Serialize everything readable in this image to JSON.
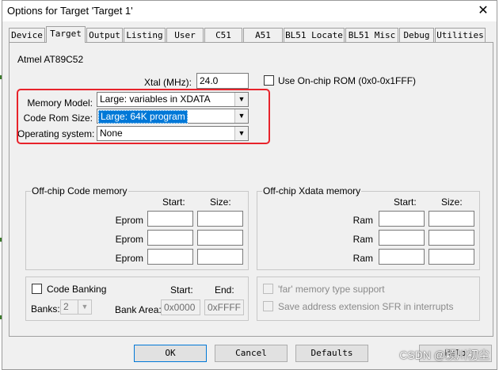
{
  "window": {
    "title": "Options for Target 'Target 1'",
    "close_symbol": "✕"
  },
  "tabs": [
    {
      "label": "Device"
    },
    {
      "label": "Target",
      "active": true
    },
    {
      "label": "Output"
    },
    {
      "label": "Listing"
    },
    {
      "label": "User"
    },
    {
      "label": "C51"
    },
    {
      "label": "A51"
    },
    {
      "label": "BL51 Locate"
    },
    {
      "label": "BL51 Misc"
    },
    {
      "label": "Debug"
    },
    {
      "label": "Utilities"
    }
  ],
  "target": {
    "device_name": "Atmel AT89C52",
    "xtal_label": "Xtal (MHz):",
    "xtal_value": "24.0",
    "onchip_rom_label": "Use On-chip ROM (0x0-0x1FFF)",
    "onchip_rom_checked": false,
    "memory_model_label": "Memory Model:",
    "memory_model_value": "Large: variables in XDATA",
    "code_rom_label": "Code Rom Size:",
    "code_rom_value": "Large: 64K program",
    "os_label": "Operating system:",
    "os_value": "None"
  },
  "offchip_code": {
    "title": "Off-chip Code memory",
    "start_header": "Start:",
    "size_header": "Size:",
    "rows": [
      {
        "label": "Eprom",
        "start": "",
        "size": ""
      },
      {
        "label": "Eprom",
        "start": "",
        "size": ""
      },
      {
        "label": "Eprom",
        "start": "",
        "size": ""
      }
    ]
  },
  "offchip_xdata": {
    "title": "Off-chip Xdata memory",
    "start_header": "Start:",
    "size_header": "Size:",
    "rows": [
      {
        "label": "Ram",
        "start": "",
        "size": ""
      },
      {
        "label": "Ram",
        "start": "",
        "size": ""
      },
      {
        "label": "Ram",
        "start": "",
        "size": ""
      }
    ]
  },
  "code_banking": {
    "label": "Code Banking",
    "checked": false,
    "banks_label": "Banks:",
    "banks_value": "2",
    "bank_area_label": "Bank Area:",
    "start_header": "Start:",
    "end_header": "End:",
    "start_value": "0x0000",
    "end_value": "0xFFFF"
  },
  "options": {
    "far_memory_label": "'far' memory type support",
    "save_sfr_label": "Save address extension SFR in interrupts"
  },
  "buttons": {
    "ok": "OK",
    "cancel": "Cancel",
    "defaults": "Defaults",
    "help": "Help"
  },
  "watermark": "CSDN @颖川初尘",
  "colors": {
    "highlight_box": "#e8232b",
    "selection": "#0078d7"
  },
  "icons": {
    "dropdown": "chevron-down-icon",
    "close": "close-icon"
  }
}
